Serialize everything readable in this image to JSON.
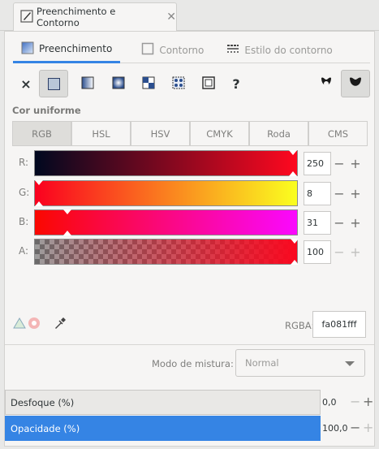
{
  "dock": {
    "tab_title": "Preenchimento e Contorno"
  },
  "mode_tabs": [
    {
      "label": "Preenchimento",
      "active": true
    },
    {
      "label": "Contorno",
      "active": false
    },
    {
      "label": "Estilo do contorno",
      "active": false
    }
  ],
  "paint_types": {
    "none_label": "×",
    "unset_label": "?"
  },
  "color_section": {
    "title": "Cor uniforme"
  },
  "color_modes": [
    "RGB",
    "HSL",
    "HSV",
    "CMYK",
    "Roda",
    "CMS"
  ],
  "color_modes_selected": "RGB",
  "sliders": {
    "r": {
      "label": "R:",
      "value": "250"
    },
    "g": {
      "label": "G:",
      "value": "8"
    },
    "b": {
      "label": "B:",
      "value": "31"
    },
    "a": {
      "label": "A:",
      "value": "100"
    }
  },
  "rgba": {
    "label": "RGBA:",
    "value": "fa081fff"
  },
  "blend": {
    "label": "Modo de mistura:",
    "value": "Normal"
  },
  "filters": {
    "blur": {
      "label": "Desfoque (%)",
      "value": "0,0"
    },
    "opacity": {
      "label": "Opacidade (%)",
      "value": "100,0",
      "level": 1.0
    }
  },
  "colors": {
    "accent": "#3584e4",
    "current": "#fa081f"
  }
}
